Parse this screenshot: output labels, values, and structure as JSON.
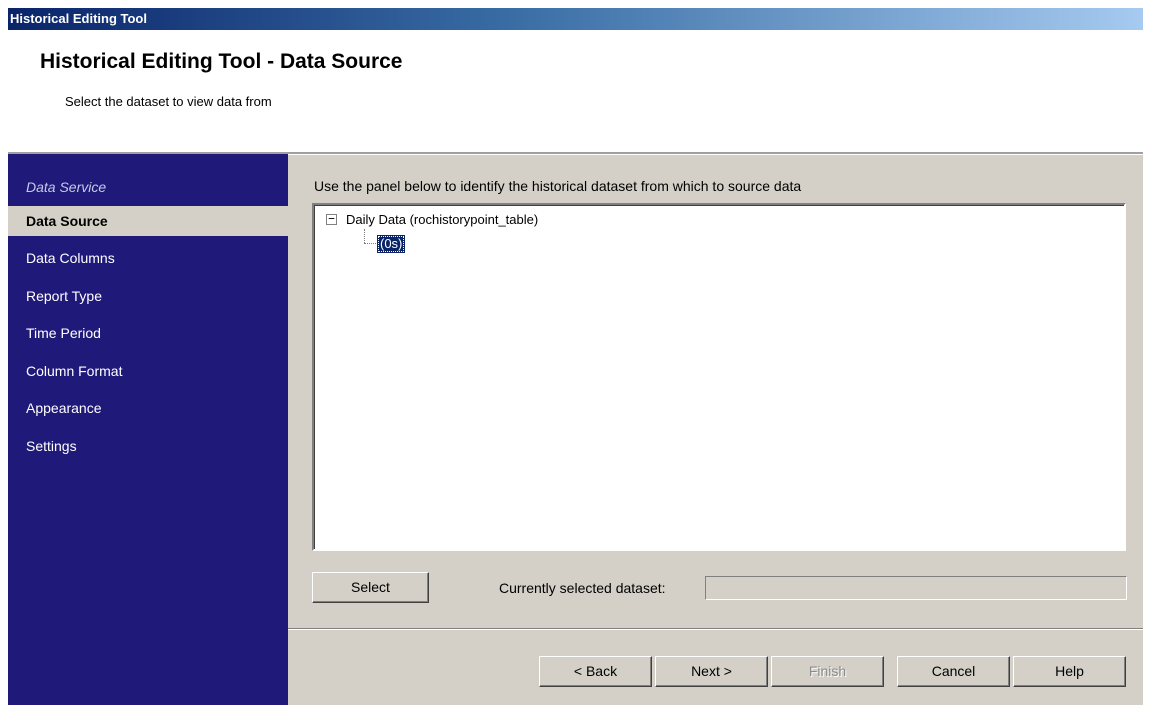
{
  "window": {
    "title": "Historical Editing Tool"
  },
  "header": {
    "title": "Historical Editing Tool - Data Source",
    "subtitle": "Select the dataset to view data from"
  },
  "sidebar": {
    "group_label": "Data Service",
    "items": [
      {
        "label": "Data Source",
        "active": true
      },
      {
        "label": "Data Columns"
      },
      {
        "label": "Report Type"
      },
      {
        "label": "Time Period"
      },
      {
        "label": "Column Format"
      },
      {
        "label": "Appearance"
      },
      {
        "label": "Settings"
      }
    ]
  },
  "main": {
    "instructions": "Use the panel below to identify the historical dataset from which to source data",
    "tree": {
      "expander": "−",
      "root_label": "Daily Data (rochistorypoint_table)",
      "child_label": "(0s)"
    },
    "select_button": "Select",
    "selected_label": "Currently selected dataset:",
    "selected_value": ""
  },
  "footer": {
    "back": "< Back",
    "next": "Next >",
    "finish": "Finish",
    "cancel": "Cancel",
    "help": "Help"
  },
  "colors": {
    "sidebar_bg": "#1f1a7a",
    "title_bar": "#0a246a",
    "selection": "#0a246a",
    "dialog_bg": "#d4d0c8"
  }
}
